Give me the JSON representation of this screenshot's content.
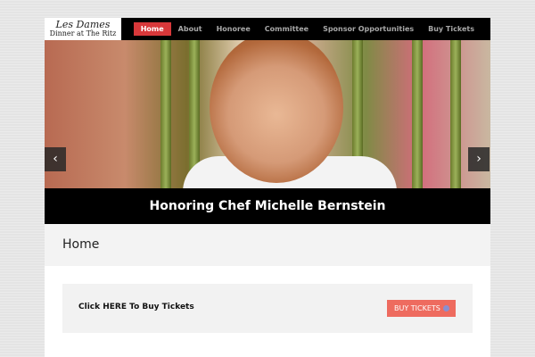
{
  "logo": {
    "line1": "Les Dames",
    "line2": "Dinner at The Ritz"
  },
  "nav": {
    "items": [
      {
        "label": "Home",
        "active": true
      },
      {
        "label": "About"
      },
      {
        "label": "Honoree"
      },
      {
        "label": "Committee"
      },
      {
        "label": "Sponsor Opportunities"
      },
      {
        "label": "Buy Tickets"
      }
    ]
  },
  "hero": {
    "caption": "Honoring Chef Michelle Bernstein",
    "prev_icon": "chevron-left-icon",
    "next_icon": "chevron-right-icon"
  },
  "page": {
    "title": "Home"
  },
  "cta": {
    "text": "Click HERE To Buy Tickets",
    "button_label": "BUY TICKETS",
    "button_icon": "ticket-icon"
  },
  "colors": {
    "accent": "#d8383a",
    "cta_button": "#ee6b5f",
    "topbar": "#000000"
  }
}
